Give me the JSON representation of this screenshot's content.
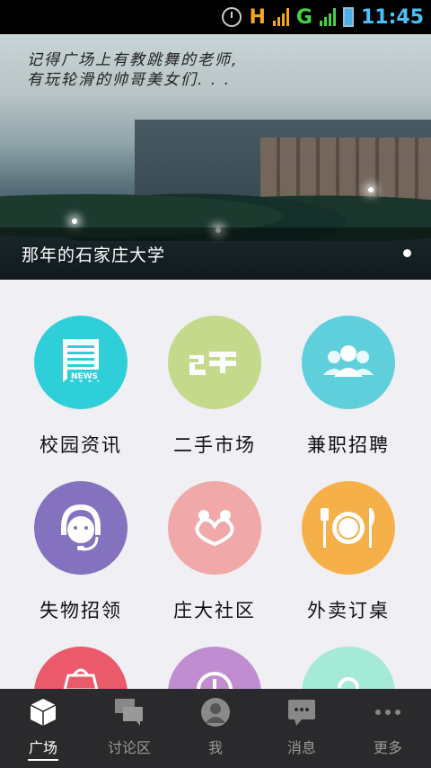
{
  "status_bar": {
    "network_1": "H",
    "network_2": "G",
    "time": "11:45"
  },
  "banner": {
    "quote_line1": "记得广场上有教跳舞的老师,",
    "quote_line2": "有玩轮滑的帅哥美女们. . .",
    "caption": "那年的石家庄大学"
  },
  "grid": [
    {
      "label": "校园资讯",
      "color": "#2fcfd9",
      "icon": "news-icon"
    },
    {
      "label": "二手市场",
      "color": "#c4d98b",
      "icon": "secondhand-icon"
    },
    {
      "label": "兼职招聘",
      "color": "#5fcfdb",
      "icon": "people-icon"
    },
    {
      "label": "失物招领",
      "color": "#8572be",
      "icon": "customer-service-icon"
    },
    {
      "label": "庄大社区",
      "color": "#f0a8a8",
      "icon": "couple-icon"
    },
    {
      "label": "外卖订桌",
      "color": "#f6b04a",
      "icon": "dining-icon"
    },
    {
      "label": "",
      "color": "#ea5a6a",
      "icon": "bag-icon"
    },
    {
      "label": "",
      "color": "#c08ed0",
      "icon": "clock-icon"
    },
    {
      "label": "",
      "color": "#a4ead6",
      "icon": "swirl-icon"
    }
  ],
  "tabs": [
    {
      "label": "广场",
      "icon": "cube-icon",
      "active": true
    },
    {
      "label": "讨论区",
      "icon": "chat-bubbles-icon",
      "active": false
    },
    {
      "label": "我",
      "icon": "user-icon",
      "active": false
    },
    {
      "label": "消息",
      "icon": "message-icon",
      "active": false
    },
    {
      "label": "更多",
      "icon": "more-dots-icon",
      "active": false
    }
  ]
}
